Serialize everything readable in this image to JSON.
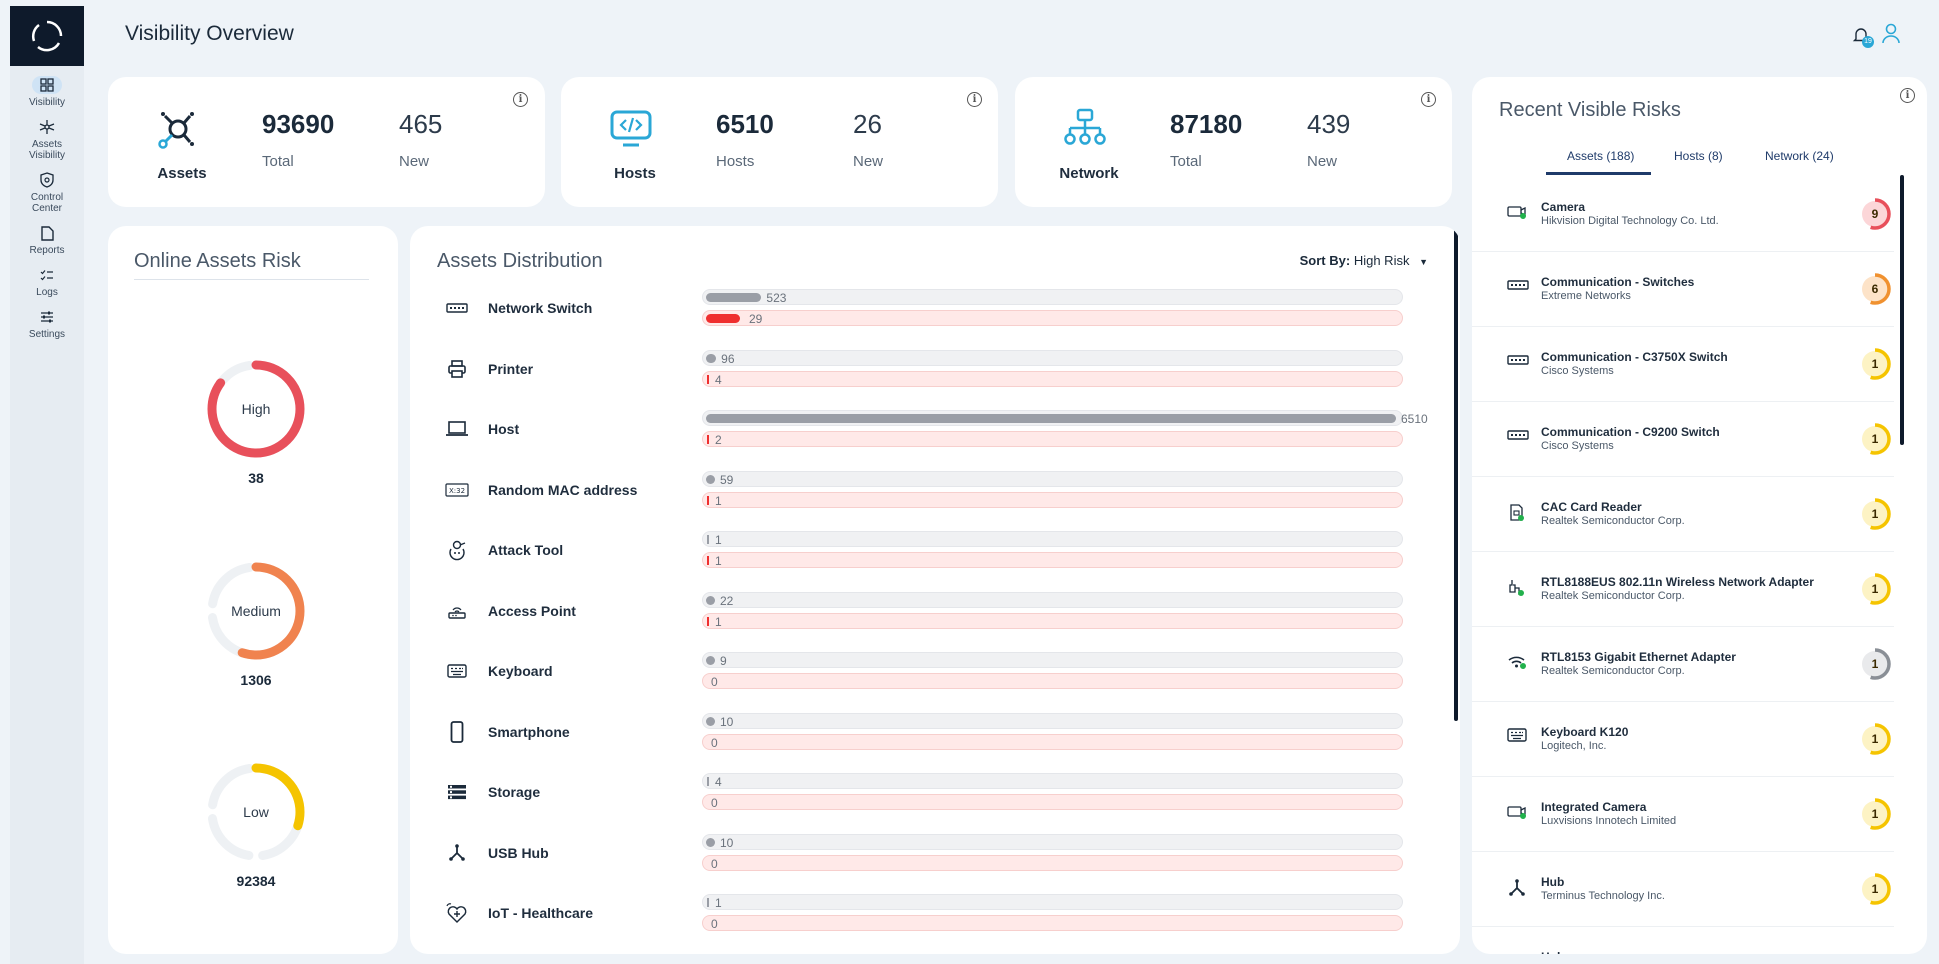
{
  "sidebar": {
    "items": [
      {
        "label": "Visibility",
        "icon": "grid-icon"
      },
      {
        "label": "Assets\nVisibility",
        "icon": "network-star-icon"
      },
      {
        "label": "Control\nCenter",
        "icon": "shield-icon"
      },
      {
        "label": "Reports",
        "icon": "document-icon"
      },
      {
        "label": "Logs",
        "icon": "checklist-icon"
      },
      {
        "label": "Settings",
        "icon": "sliders-icon"
      }
    ]
  },
  "header": {
    "title": "Visibility Overview",
    "notification_count": "19"
  },
  "stats": {
    "assets": {
      "label": "Assets",
      "total": "93690",
      "total_label": "Total",
      "new": "465",
      "new_label": "New"
    },
    "hosts": {
      "label": "Hosts",
      "total": "6510",
      "total_label": "Hosts",
      "new": "26",
      "new_label": "New"
    },
    "network": {
      "label": "Network",
      "total": "87180",
      "total_label": "Total",
      "new": "439",
      "new_label": "New"
    }
  },
  "online_risk": {
    "title": "Online Assets Risk",
    "levels": [
      {
        "label": "High",
        "value": "38",
        "color": "#e8505b",
        "fraction": 0.85
      },
      {
        "label": "Medium",
        "value": "1306",
        "color": "#f0834f",
        "fraction": 0.55
      },
      {
        "label": "Low",
        "value": "92384",
        "color": "#f5c400",
        "fraction": 0.3
      }
    ]
  },
  "distribution": {
    "title": "Assets Distribution",
    "sort_label": "Sort By:",
    "sort_value": "High Risk",
    "max_total": 6510,
    "rows": [
      {
        "name": "Network Switch",
        "icon": "switch-icon",
        "total": 523,
        "risk": 29
      },
      {
        "name": "Printer",
        "icon": "printer-icon",
        "total": 96,
        "risk": 4
      },
      {
        "name": "Host",
        "icon": "laptop-icon",
        "total": 6510,
        "risk": 2
      },
      {
        "name": "Random MAC address",
        "icon": "mac-address-icon",
        "total": 59,
        "risk": 1
      },
      {
        "name": "Attack Tool",
        "icon": "attack-tool-icon",
        "total": 1,
        "risk": 1
      },
      {
        "name": "Access Point",
        "icon": "access-point-icon",
        "total": 22,
        "risk": 1
      },
      {
        "name": "Keyboard",
        "icon": "keyboard-icon",
        "total": 9,
        "risk": 0
      },
      {
        "name": "Smartphone",
        "icon": "smartphone-icon",
        "total": 10,
        "risk": 0
      },
      {
        "name": "Storage",
        "icon": "storage-icon",
        "total": 4,
        "risk": 0
      },
      {
        "name": "USB Hub",
        "icon": "usb-hub-icon",
        "total": 10,
        "risk": 0
      },
      {
        "name": "IoT - Healthcare",
        "icon": "healthcare-icon",
        "total": 1,
        "risk": 0
      }
    ]
  },
  "recent_risks": {
    "title": "Recent Visible Risks",
    "tabs": [
      "Assets (188)",
      "Hosts (8)",
      "Network (24)"
    ],
    "items": [
      {
        "name": "Camera",
        "vendor": "Hikvision Digital Technology Co. Ltd.",
        "score": "9",
        "color": "#e8505b",
        "icon": "camera-icon"
      },
      {
        "name": "Communication - Switches",
        "vendor": "Extreme Networks",
        "score": "6",
        "color": "#f0912f",
        "icon": "switch-icon"
      },
      {
        "name": "Communication - C3750X Switch",
        "vendor": "Cisco Systems",
        "score": "1",
        "color": "#f5c400",
        "icon": "switch-icon"
      },
      {
        "name": "Communication - C9200 Switch",
        "vendor": "Cisco Systems",
        "score": "1",
        "color": "#f5c400",
        "icon": "switch-icon"
      },
      {
        "name": "CAC Card Reader",
        "vendor": "Realtek Semiconductor Corp.",
        "score": "1",
        "color": "#f5c400",
        "icon": "card-reader-icon"
      },
      {
        "name": "RTL8188EUS 802.11n Wireless Network Adapter",
        "vendor": "Realtek Semiconductor Corp.",
        "score": "1",
        "color": "#f5c400",
        "icon": "wireless-adapter-icon"
      },
      {
        "name": "RTL8153 Gigabit Ethernet Adapter",
        "vendor": "Realtek Semiconductor Corp.",
        "score": "1",
        "color": "#8a8f96",
        "icon": "wifi-icon"
      },
      {
        "name": "Keyboard K120",
        "vendor": "Logitech, Inc.",
        "score": "1",
        "color": "#f5c400",
        "icon": "keyboard-icon"
      },
      {
        "name": "Integrated Camera",
        "vendor": "Luxvisions Innotech Limited",
        "score": "1",
        "color": "#f5c400",
        "icon": "camera-icon"
      },
      {
        "name": "Hub",
        "vendor": "Terminus Technology Inc.",
        "score": "1",
        "color": "#f5c400",
        "icon": "usb-hub-icon"
      },
      {
        "name": "Hub",
        "vendor": "",
        "score": "",
        "color": "#f5c400",
        "icon": "usb-hub-icon"
      }
    ]
  }
}
